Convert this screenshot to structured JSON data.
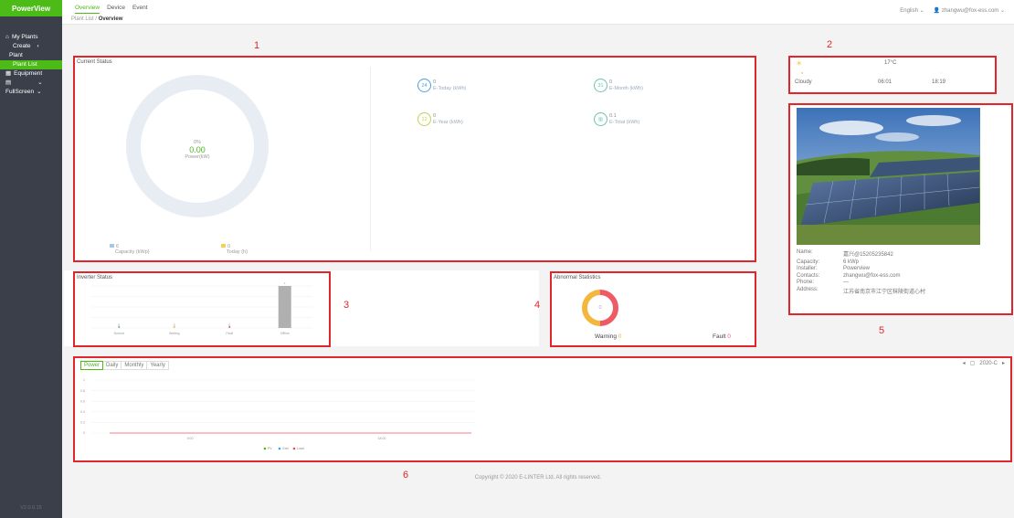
{
  "sidebar": {
    "logo": "PowerView",
    "items": [
      {
        "label": "My Plants",
        "icon": "home-icon"
      },
      {
        "label": "Create"
      },
      {
        "label": "Plant"
      },
      {
        "label": "Plant List"
      },
      {
        "label": "Equipment",
        "icon": "grid-icon"
      },
      {
        "label": "FullScreen"
      }
    ],
    "version": "V2.0.0.15"
  },
  "header": {
    "tabs": [
      "Overview",
      "Device",
      "Event"
    ],
    "active_tab": "Overview",
    "breadcrumb_parent": "Plant List",
    "breadcrumb_sep": "/",
    "breadcrumb_current": "Overview",
    "language": "English",
    "user": "zhangwu@fox-ess.com"
  },
  "markers": [
    "1",
    "2",
    "3",
    "4",
    "5",
    "6"
  ],
  "current_status": {
    "title": "Current Status",
    "gauge_percent": "0%",
    "power_value": "0.00",
    "power_label": "Power(kW)",
    "capacity_value": "6",
    "capacity_label": "Capacity (kWp)",
    "today_value": "0",
    "today_label": "Today (h)",
    "stats": [
      {
        "icon": "24",
        "value": "0",
        "label": "E-Today (kWh)",
        "color": "#4aa0e6"
      },
      {
        "icon": "31",
        "value": "0",
        "label": "E-Month (kWh)",
        "color": "#6cc3b2"
      },
      {
        "icon": "12",
        "value": "0",
        "label": "E-Year (kWh)",
        "color": "#c8d04a"
      },
      {
        "icon": "",
        "value": "0.1",
        "label": "E-Total (kWh)",
        "color": "#6cc3b2"
      }
    ]
  },
  "weather": {
    "temperature": "17°C",
    "condition": "Cloudy",
    "sunrise": "06:01",
    "sunset": "18:19"
  },
  "plant_info": {
    "labels": [
      "Name:",
      "Capacity:",
      "Installer:",
      "Contacts:",
      "Phone:",
      "Address:"
    ],
    "values": [
      "嘉兴@15205235842",
      "6 kWp",
      "Powerview",
      "zhangwu@fox-ess.com",
      "—",
      "江苏省南京市江宁区秣陵街道心村"
    ]
  },
  "inverter_status": {
    "title": "Inverter Status",
    "categories": [
      "Normal",
      "Waiting",
      "Fault",
      "Offline"
    ],
    "values": [
      0,
      0,
      0,
      1
    ],
    "colors": [
      "#5bbf6a",
      "#f0b84a",
      "#e0555a",
      "#b0b0b0"
    ]
  },
  "abnormal": {
    "title": "Abnormal Statistics",
    "total": "0",
    "warning_label": "Warning",
    "warning_value": "0",
    "fault_label": "Fault",
    "fault_value": "0"
  },
  "power_chart": {
    "tabs": [
      "Power",
      "Daily",
      "Monthly",
      "Yearly"
    ],
    "active_tab": "Power",
    "date": "2020-C",
    "legend": [
      "PV",
      "Grid",
      "Load"
    ],
    "legend_colors": [
      "#4cbb17",
      "#4aa0e6",
      "#e0555a"
    ]
  },
  "chart_data": {
    "type": "line",
    "y_ticks": [
      "1",
      "0.8",
      "0.6",
      "0.4",
      "0.2",
      "0"
    ],
    "x_ticks": [
      "9:00",
      "18:00"
    ],
    "series": [
      {
        "name": "PV",
        "values": [
          0,
          0
        ]
      },
      {
        "name": "Grid",
        "values": [
          0,
          0
        ]
      },
      {
        "name": "Load",
        "values": [
          0,
          0
        ]
      }
    ],
    "ylim": [
      0,
      1
    ]
  },
  "footer": {
    "copyright": "Copyright © 2020 E-LINTER Ltd. All rights reserved."
  }
}
